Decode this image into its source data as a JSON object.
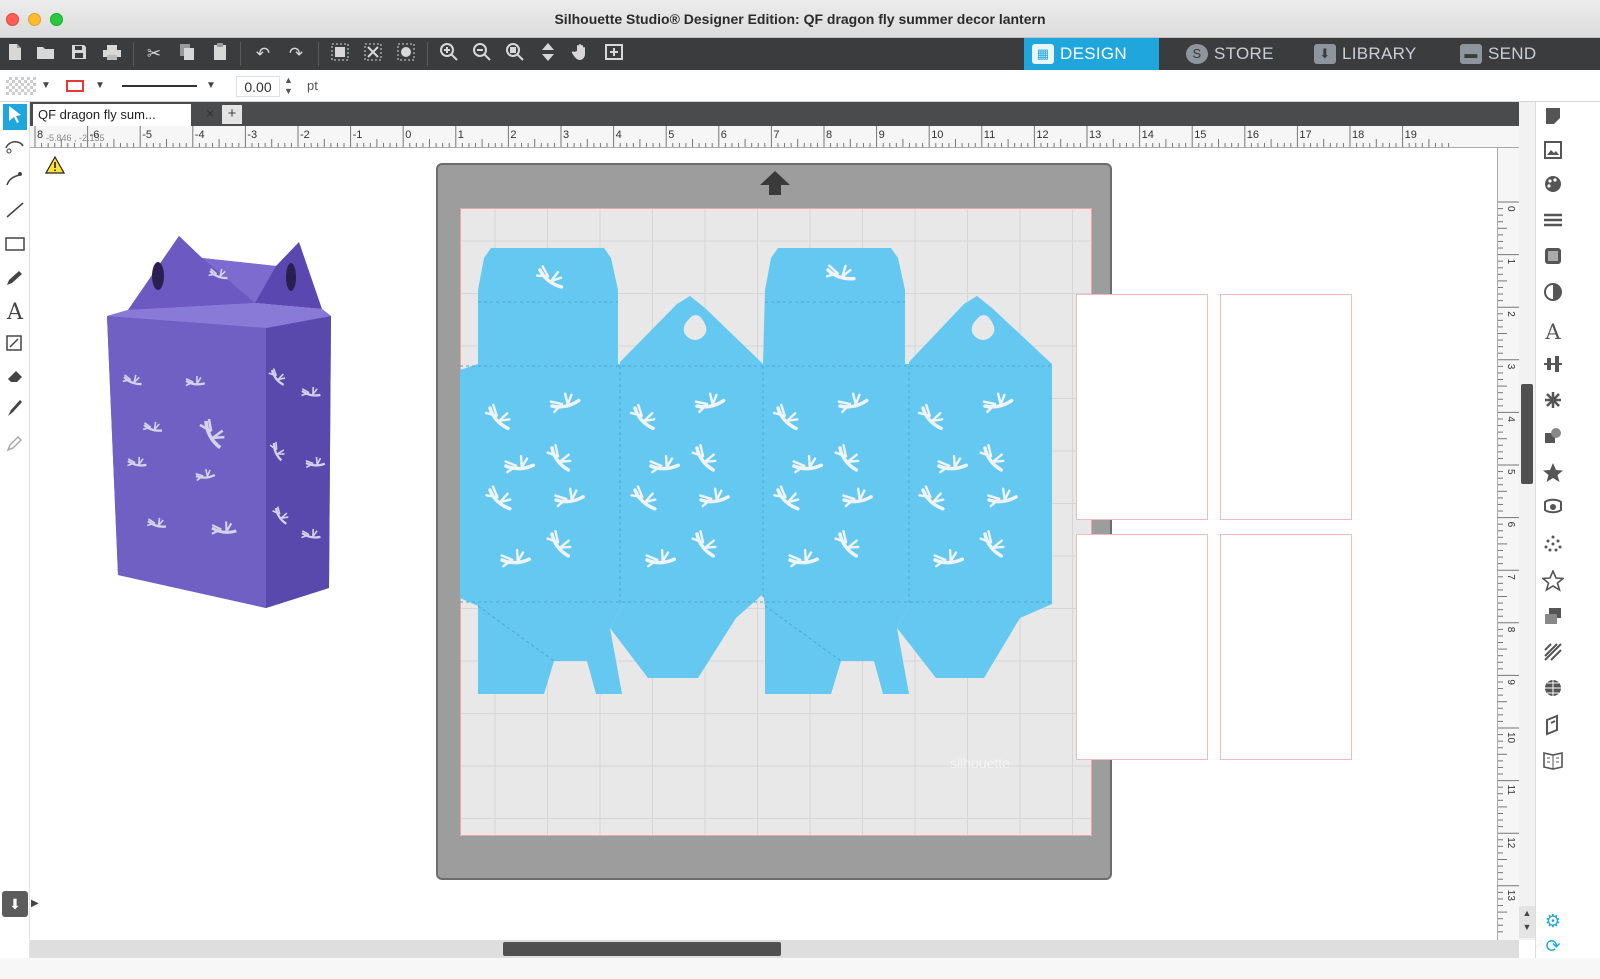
{
  "window": {
    "title": "Silhouette Studio® Designer Edition: QF dragon fly summer decor lantern"
  },
  "nav_tabs": [
    {
      "label": "DESIGN",
      "icon": "grid-icon",
      "active": true
    },
    {
      "label": "STORE",
      "icon": "silhouette-s-icon",
      "active": false
    },
    {
      "label": "LIBRARY",
      "icon": "download-icon",
      "active": false
    },
    {
      "label": "SEND",
      "icon": "cutter-icon",
      "active": false
    }
  ],
  "properties": {
    "line_width": "0.00",
    "unit": "pt",
    "line_color": "#e53935"
  },
  "document": {
    "tab_label": "QF dragon fly sum...",
    "close_glyph": "×",
    "add_glyph": "+"
  },
  "rulers": {
    "coords": "-5.846 , -2.135",
    "horizontal": [
      "8",
      "-6",
      "-5",
      "-4",
      "-3",
      "-2",
      "-1",
      "0",
      "1",
      "2",
      "3",
      "4",
      "5",
      "6",
      "7",
      "8",
      "9",
      "10",
      "11",
      "12",
      "13",
      "14",
      "15",
      "16",
      "17",
      "18",
      "19"
    ],
    "vertical": [
      "0",
      "1",
      "2",
      "3",
      "4",
      "5",
      "6",
      "7",
      "8",
      "9",
      "10",
      "11",
      "12",
      "13"
    ]
  },
  "mat": {
    "watermark": "silhouette"
  },
  "colors": {
    "accent": "#1fa6dd",
    "design_fill": "#64c8f0",
    "lantern": "#6f5cc2",
    "mat": "#9d9d9d",
    "page_border": "#f3bcbc"
  }
}
